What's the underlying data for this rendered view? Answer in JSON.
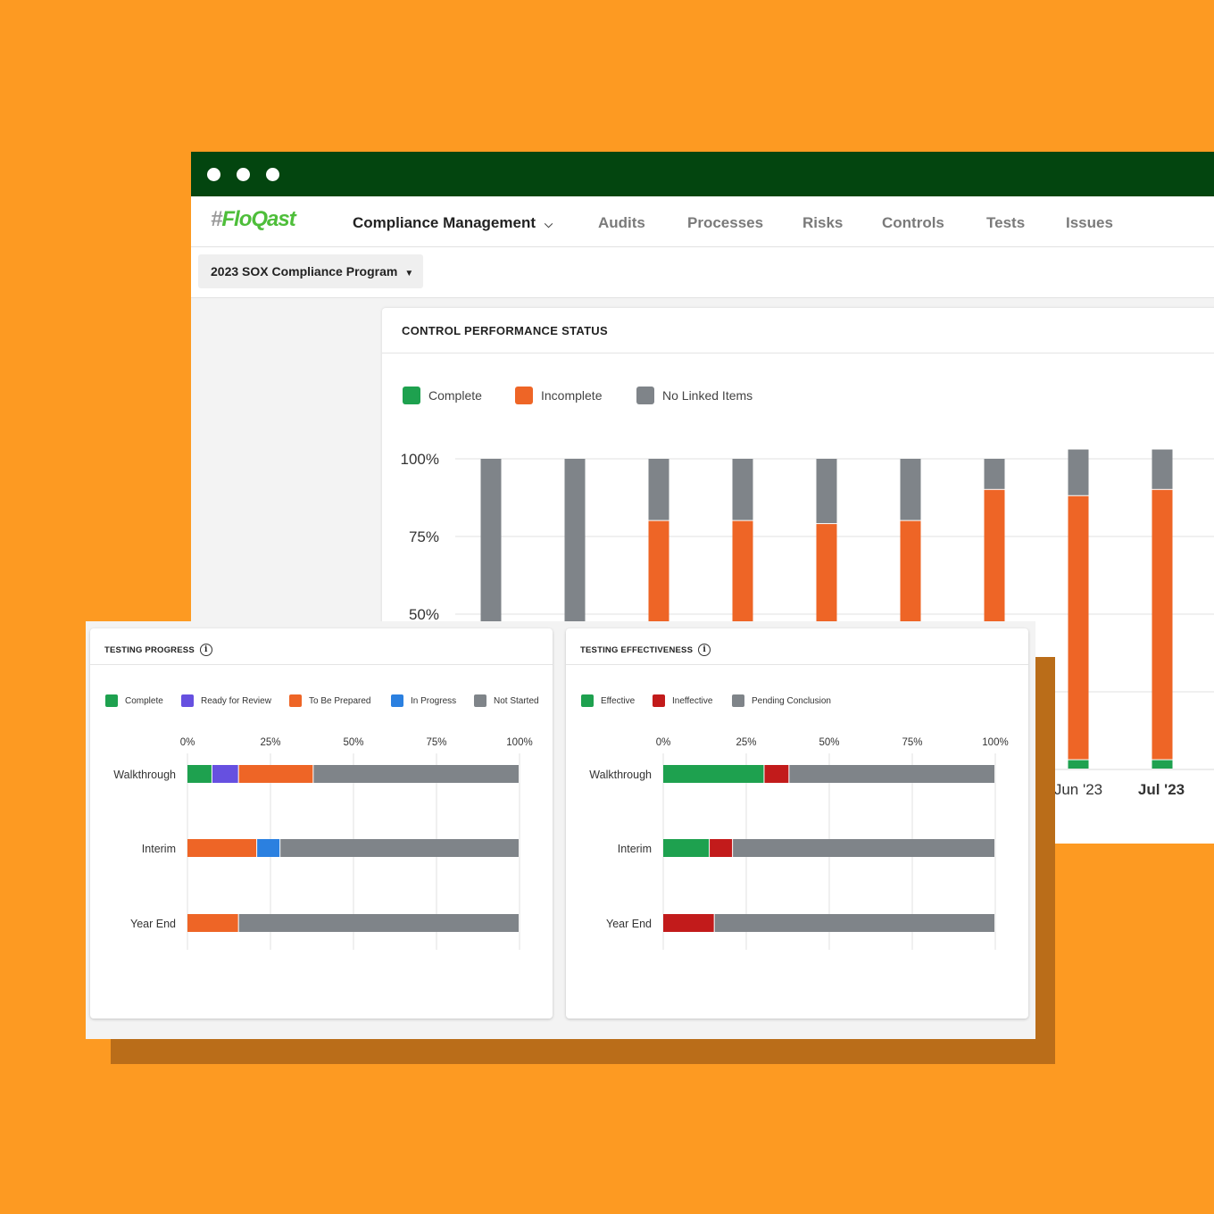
{
  "window": {
    "brand": "FloQast",
    "nav": {
      "primary": "Compliance Management",
      "items": [
        "Audits",
        "Processes",
        "Risks",
        "Controls",
        "Tests",
        "Issues"
      ]
    },
    "program_select": "2023 SOX Compliance Program"
  },
  "colors": {
    "green": "#1EA14F",
    "orange": "#EE6526",
    "gray": "#7F8489",
    "purple": "#6650E0",
    "blue": "#2B80E0",
    "red": "#C21B1B",
    "titlebar": "#03450F",
    "background": "#FD9A22"
  },
  "control_performance": {
    "title": "CONTROL PERFORMANCE STATUS",
    "legend": [
      "Complete",
      "Incomplete",
      "No Linked Items"
    ],
    "chart_data": {
      "type": "bar",
      "stacked": true,
      "y_tick_labels": [
        "100%",
        "75%",
        "50%"
      ],
      "ylim": [
        0,
        100
      ],
      "x_tick_labels_visible": [
        "Jun '23",
        "Jul '23"
      ],
      "series": [
        {
          "name": "Complete",
          "values": [
            0,
            0,
            0,
            0,
            0,
            0,
            0,
            3,
            3
          ]
        },
        {
          "name": "Incomplete",
          "values": [
            0,
            0,
            80,
            80,
            79,
            80,
            90,
            85,
            87
          ]
        },
        {
          "name": "No Linked Items",
          "values": [
            100,
            100,
            20,
            20,
            21,
            20,
            10,
            15,
            13
          ]
        }
      ]
    }
  },
  "testing_progress": {
    "title": "TESTING PROGRESS",
    "info_icon": "i",
    "legend": [
      "Complete",
      "Ready for Review",
      "To Be Prepared",
      "In Progress",
      "Not Started"
    ],
    "chart_data": {
      "type": "bar",
      "orientation": "horizontal",
      "stacked": true,
      "categories": [
        "Walkthrough",
        "Interim",
        "Year End"
      ],
      "x_tick_labels": [
        "0%",
        "25%",
        "50%",
        "75%",
        "100%"
      ],
      "xlim": [
        0,
        100
      ],
      "series": [
        {
          "name": "Complete",
          "values": [
            7.5,
            0,
            0
          ]
        },
        {
          "name": "Ready for Review",
          "values": [
            8,
            0,
            0
          ]
        },
        {
          "name": "To Be Prepared",
          "values": [
            22.5,
            21,
            15.5
          ]
        },
        {
          "name": "In Progress",
          "values": [
            0,
            7,
            0
          ]
        },
        {
          "name": "Not Started",
          "values": [
            62,
            72,
            84.5
          ]
        }
      ]
    }
  },
  "testing_effectiveness": {
    "title": "TESTING EFFECTIVENESS",
    "info_icon": "i",
    "legend": [
      "Effective",
      "Ineffective",
      "Pending Conclusion"
    ],
    "chart_data": {
      "type": "bar",
      "orientation": "horizontal",
      "stacked": true,
      "categories": [
        "Walkthrough",
        "Interim",
        "Year End"
      ],
      "x_tick_labels": [
        "0%",
        "25%",
        "50%",
        "75%",
        "100%"
      ],
      "xlim": [
        0,
        100
      ],
      "series": [
        {
          "name": "Effective",
          "values": [
            30.5,
            14,
            0
          ]
        },
        {
          "name": "Ineffective",
          "values": [
            7.5,
            7,
            15.5
          ]
        },
        {
          "name": "Pending Conclusion",
          "values": [
            62,
            79,
            84.5
          ]
        }
      ]
    }
  }
}
